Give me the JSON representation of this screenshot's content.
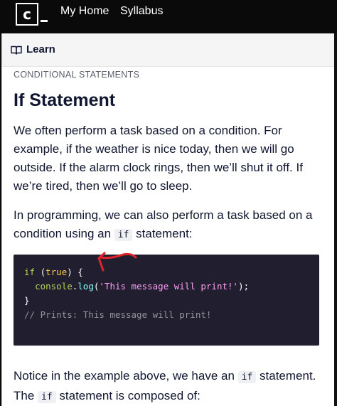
{
  "topbar": {
    "logo_letter": "c",
    "nav": [
      "My Home",
      "Syllabus"
    ]
  },
  "learn_bar": {
    "label": "Learn",
    "icon": "book-icon"
  },
  "lesson": {
    "kicker": "CONDITIONAL STATEMENTS",
    "title": "If Statement",
    "para1": "We often perform a task based on a condition. For example, if the weather is nice today, then we will go outside. If the alarm clock rings, then we’ll shut it off. If we’re tired, then we’ll go to sleep.",
    "para2_before": "In programming, we can also perform a task based on a condition using an ",
    "para2_code": "if",
    "para2_after": " statement:",
    "para3_a": "Notice in the example above, we have an ",
    "para3_code1": "if",
    "para3_b": " statement. The ",
    "para3_code2": "if",
    "para3_c": " statement is composed of:"
  },
  "code": {
    "l1_kw": "if",
    "l1_open": " (",
    "l1_const": "true",
    "l1_close": ") {",
    "l2_indent": "  ",
    "l2_obj": "console",
    "l2_dot": ".",
    "l2_fn": "log",
    "l2_paren_open": "(",
    "l2_str": "'This message will print!'",
    "l2_paren_close": ");",
    "l3": "}",
    "l4": "// Prints: This message will print!"
  },
  "colors": {
    "topbar_bg": "#0a0a0a",
    "code_bg": "#211e2f",
    "annotation": "#e0242b"
  }
}
